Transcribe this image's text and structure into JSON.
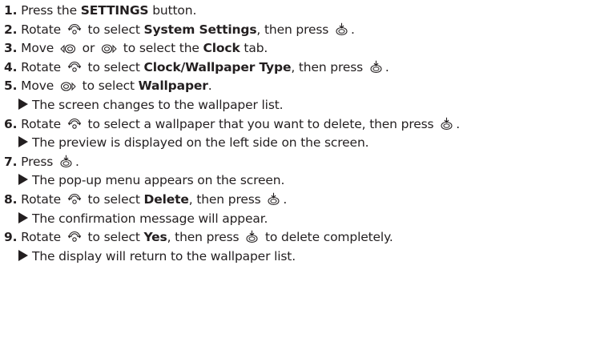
{
  "steps": [
    {
      "num": "1.",
      "pre": "Press the ",
      "b1": "SETTINGS",
      "mid": " button.",
      "b2": "",
      "post": "",
      "tail": ""
    },
    {
      "num": "2.",
      "pre": "Rotate ",
      "b1": "System Settings",
      "mid": " to select ",
      "b2": "",
      "post": ", then press ",
      "tail": "."
    },
    {
      "num": "3.",
      "pre": "Move ",
      "b1": "Clock",
      "mid": " or ",
      "b2": "",
      "post": " to select the ",
      "tail": " tab."
    },
    {
      "num": "4.",
      "pre": "Rotate ",
      "b1": "Clock/Wallpaper Type",
      "mid": " to select ",
      "b2": "",
      "post": ", then press ",
      "tail": "."
    },
    {
      "num": "5.",
      "pre": "Move ",
      "b1": "Wallpaper",
      "mid": " to select ",
      "b2": "",
      "post": ".",
      "tail": ""
    },
    {
      "num": "6.",
      "pre": "Rotate ",
      "b1": "",
      "mid": " to select a wallpaper that you want to delete, then press ",
      "b2": "",
      "post": ".",
      "tail": ""
    },
    {
      "num": "7.",
      "pre": "Press ",
      "b1": "",
      "mid": ".",
      "b2": "",
      "post": "",
      "tail": ""
    },
    {
      "num": "8.",
      "pre": "Rotate ",
      "b1": "Delete",
      "mid": " to select ",
      "b2": "",
      "post": ", then press ",
      "tail": "."
    },
    {
      "num": "9.",
      "pre": "Rotate ",
      "b1": "Yes",
      "mid": " to select ",
      "b2": "",
      "post": ", then press ",
      "tail": " to delete completely."
    }
  ],
  "results": {
    "r5": "The screen changes to the wallpaper list.",
    "r6": "The preview is displayed on the left side on the screen.",
    "r7": "The pop-up menu appears on the screen.",
    "r8": "The confirmation message will appear.",
    "r9": "The display will return to the wallpaper list."
  },
  "icons": {
    "dial": "interface-dial-rotate-icon",
    "enter": "enter-press-icon",
    "move_left": "move-left-icon",
    "move_right": "move-right-icon"
  }
}
